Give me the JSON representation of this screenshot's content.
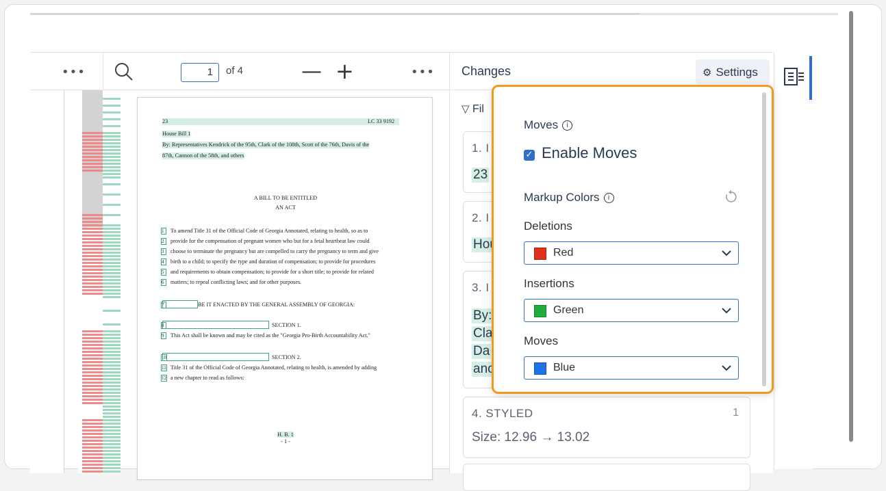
{
  "toolbar": {
    "more_left": "•••",
    "page_current": "1",
    "page_of": "of 4",
    "zoom_out": "—",
    "zoom_in": "+",
    "more_right": "•••"
  },
  "changes": {
    "title": "Changes",
    "settings_label": "Settings",
    "filter_label": "Fil",
    "cards": [
      {
        "title": "1. I",
        "body": "23"
      },
      {
        "title": "2. I",
        "body": "Hou"
      },
      {
        "title": "3. I",
        "body_lines": [
          "By:",
          "Cla",
          "Da",
          "anc"
        ]
      },
      {
        "title": "4. STYLED",
        "count": "1",
        "body": "Size: 12.96 → 13.02"
      }
    ]
  },
  "settings_popup": {
    "moves_heading": "Moves",
    "enable_moves_label": "Enable Moves",
    "enable_moves_checked": true,
    "markup_colors_heading": "Markup Colors",
    "deletions_label": "Deletions",
    "deletions_value": "Red",
    "deletions_color": "#e0301e",
    "insertions_label": "Insertions",
    "insertions_value": "Green",
    "insertions_color": "#1fae3b",
    "moves_label": "Moves",
    "moves_value": "Blue",
    "moves_color": "#1e73e8"
  },
  "document": {
    "lines": [
      {
        "t": "23",
        "right": "LC 33 9192"
      },
      {
        "t": "House Bill 1"
      },
      {
        "t": "By: Representatives Kendrick of the 95th, Clark of the 108th, Scott of the 76th, Davis of the"
      },
      {
        "t": "87th, Cannon of the 58th, and others"
      },
      {
        "t": "A BILL TO BE ENTITLED"
      },
      {
        "t": "AN ACT"
      },
      {
        "t": "To amend Title 31 of the Official Code of Georgia Annotated, relating to health, so as to"
      },
      {
        "t": "provide for the compensation of pregnant women who but for a fetal heartbeat law could"
      },
      {
        "t": "choose to terminate the pregnancy but are compelled to carry the pregnancy to term and give"
      },
      {
        "t": "birth to a child; to specify the type and duration of compensation; to provide for procedures"
      },
      {
        "t": "and requirements to obtain compensation; to provide for a short title; to provide for related"
      },
      {
        "t": "matters; to repeal conflicting laws; and for other purposes."
      },
      {
        "t": "BE IT ENACTED BY THE GENERAL ASSEMBLY OF GEORGIA:"
      },
      {
        "t": "SECTION 1."
      },
      {
        "t": "This Act shall be known and may be cited as the \"Georgia Pro-Birth Accountability Act.\""
      },
      {
        "t": "SECTION 2."
      },
      {
        "t": "Title 31 of the Official Code of Georgia Annotated, relating to health, is amended by adding"
      },
      {
        "t": "a new chapter to read as follows:"
      },
      {
        "t": "H. B. 1"
      },
      {
        "t": "- 1 -"
      }
    ],
    "line_numbers": [
      "1",
      "2",
      "3",
      "4",
      "5",
      "6",
      "7",
      "8",
      "9",
      "10",
      "11",
      "12"
    ]
  }
}
